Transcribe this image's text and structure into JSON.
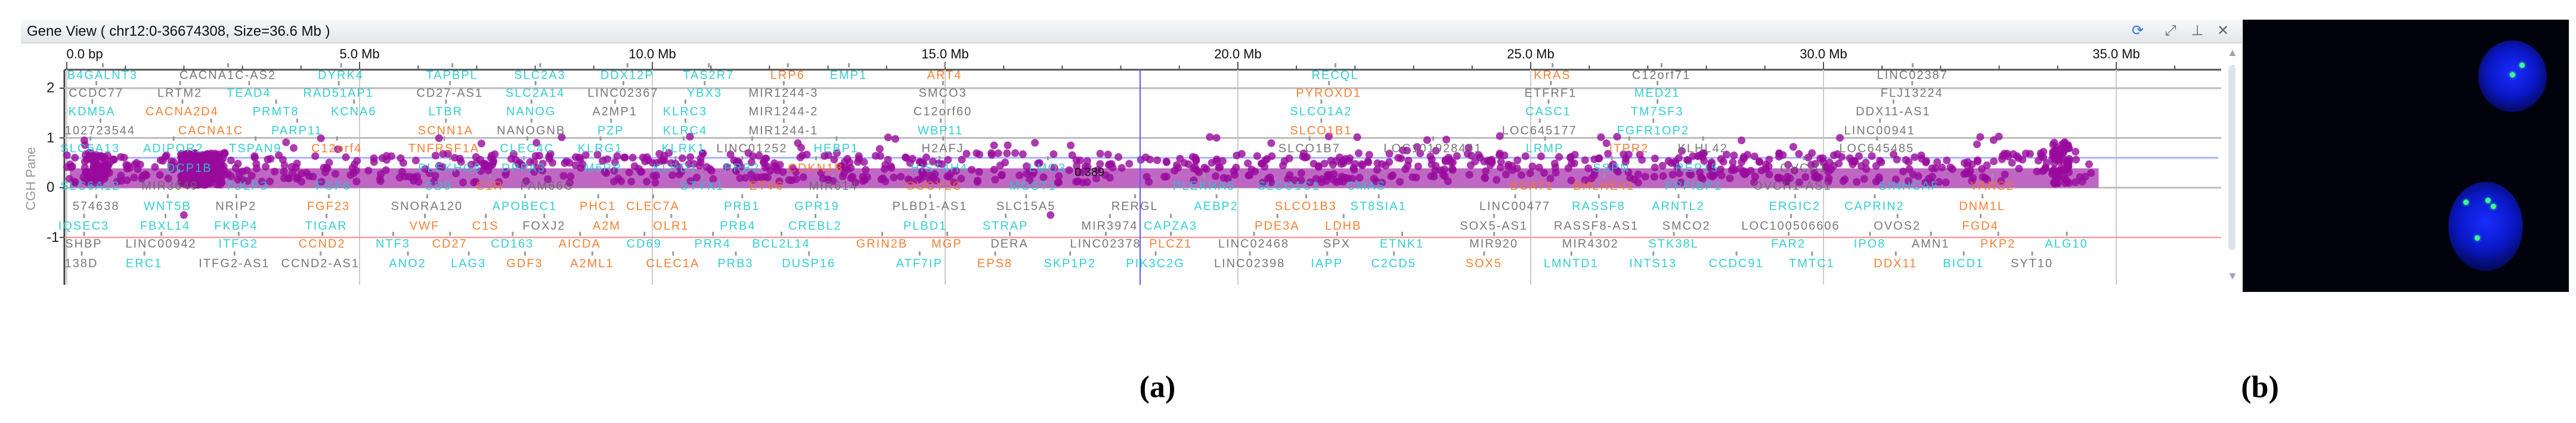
{
  "window": {
    "title": "Gene View ( chr12:0-36674308, Size=36.6 Mb )",
    "icons": [
      "refresh-icon",
      "expand-icon",
      "pin-icon",
      "close-icon"
    ]
  },
  "axis": {
    "x_ticks": [
      {
        "mb": 0,
        "label": "0.0 bp"
      },
      {
        "mb": 5,
        "label": "5.0 Mb"
      },
      {
        "mb": 10,
        "label": "10.0 Mb"
      },
      {
        "mb": 15,
        "label": "15.0 Mb"
      },
      {
        "mb": 20,
        "label": "20.0 Mb"
      },
      {
        "mb": 25,
        "label": "25.0 Mb"
      },
      {
        "mb": 30,
        "label": "30.0 Mb"
      },
      {
        "mb": 35,
        "label": "35.0 Mb"
      }
    ],
    "y_ticks": [
      {
        "v": 2,
        "label": "2"
      },
      {
        "v": 1,
        "label": "1"
      },
      {
        "v": 0,
        "label": "0"
      },
      {
        "v": -1,
        "label": "-1"
      }
    ],
    "y_label": "CGH Pane"
  },
  "colors": {
    "c": "#1fc8cf",
    "o": "#f5731e",
    "g": "#6a6a6a",
    "point": "#980a9c",
    "band": "#b44db8",
    "gain_line": "#aab0ff",
    "loss_line": "#f08a8a",
    "cursor": "#5b5bff"
  },
  "cgh": {
    "segment_mean_label": "0.389",
    "segment_mean": 0.389,
    "segment_start_mb": 0,
    "segment_end_mb": 34.7,
    "gain_threshold": 0.6,
    "loss_threshold": -1,
    "cursor_mb": 18.33
  },
  "gene_rows": [
    [
      [
        "B4GALNT3",
        0.61,
        "c"
      ],
      [
        "CACNA1C-AS2",
        2.75,
        "g"
      ],
      [
        "DYRK4",
        4.68,
        "c"
      ],
      [
        "TAPBPL",
        6.58,
        "c"
      ],
      [
        "SLC2A3",
        8.08,
        "c"
      ],
      [
        "DDX12P",
        9.57,
        "c"
      ],
      [
        "TAS2R7",
        10.96,
        "c"
      ],
      [
        "LRP6",
        12.31,
        "o"
      ],
      [
        "EMP1",
        13.35,
        "c"
      ],
      [
        "ART4",
        14.99,
        "o"
      ],
      [
        "RECQL",
        21.66,
        "c"
      ],
      [
        "KRAS",
        25.37,
        "o"
      ],
      [
        "C12orf71",
        27.23,
        "g"
      ],
      [
        "LINC02387",
        31.52,
        "g"
      ]
    ],
    [
      [
        "CCDC77",
        0.5,
        "g"
      ],
      [
        "LRTM2",
        1.93,
        "g"
      ],
      [
        "TEAD4",
        3.11,
        "c"
      ],
      [
        "RAD51AP1",
        4.64,
        "c"
      ],
      [
        "CD27-AS1",
        6.54,
        "g"
      ],
      [
        "SLC2A14",
        8.0,
        "c"
      ],
      [
        "LINC02367",
        9.5,
        "g"
      ],
      [
        "YBX3",
        10.89,
        "c"
      ],
      [
        "MIR1244-3",
        12.24,
        "g"
      ],
      [
        "SMCO3",
        14.96,
        "g"
      ],
      [
        "PYROXD1",
        21.55,
        "o"
      ],
      [
        "ETFRF1",
        25.34,
        "g"
      ],
      [
        "MED21",
        27.16,
        "c"
      ],
      [
        "FLJ13224",
        31.51,
        "g"
      ]
    ],
    [
      [
        "KDM5A",
        0.43,
        "c"
      ],
      [
        "CACNA2D4",
        1.97,
        "o"
      ],
      [
        "PRMT8",
        3.57,
        "c"
      ],
      [
        "KCNA6",
        4.9,
        "c"
      ],
      [
        "LTBR",
        6.47,
        "c"
      ],
      [
        "NANOG",
        7.93,
        "c"
      ],
      [
        "A2MP1",
        9.36,
        "g"
      ],
      [
        "KLRC3",
        10.56,
        "c"
      ],
      [
        "MIR1244-2",
        12.24,
        "g"
      ],
      [
        "C12orf60",
        14.96,
        "g"
      ],
      [
        "SLCO1A2",
        21.42,
        "c"
      ],
      [
        "CASC1",
        25.3,
        "c"
      ],
      [
        "TM7SF3",
        27.16,
        "c"
      ],
      [
        "DDX11-AS1",
        31.19,
        "g"
      ]
    ],
    [
      [
        "102723544",
        0.57,
        "g"
      ],
      [
        "CACNA1C",
        2.46,
        "o"
      ],
      [
        "PARP11",
        3.93,
        "c"
      ],
      [
        "SCNN1A",
        6.47,
        "o"
      ],
      [
        "NANOGNB",
        7.93,
        "g"
      ],
      [
        "PZP",
        9.29,
        "c"
      ],
      [
        "KLRC4",
        10.56,
        "c"
      ],
      [
        "MIR1244-1",
        12.24,
        "g"
      ],
      [
        "WBP11",
        14.92,
        "c"
      ],
      [
        "SLCO1B1",
        21.42,
        "o"
      ],
      [
        "LOC645177",
        25.15,
        "g"
      ],
      [
        "FGFR1OP2",
        27.09,
        "c"
      ],
      [
        "LINC00941",
        30.96,
        "g"
      ]
    ],
    [
      [
        "SLC6A13",
        0.4,
        "c"
      ],
      [
        "ADIPOR2",
        1.82,
        "c"
      ],
      [
        "TSPAN9",
        3.22,
        "c"
      ],
      [
        "C12orf4",
        4.61,
        "o"
      ],
      [
        "TNFRSF1A",
        6.44,
        "o"
      ],
      [
        "CLEC4C",
        7.86,
        "c"
      ],
      [
        "KLRG1",
        9.11,
        "c"
      ],
      [
        "KLRK1",
        10.53,
        "c"
      ],
      [
        "LINC01252",
        11.7,
        "g"
      ],
      [
        "HEBP1",
        13.14,
        "c"
      ],
      [
        "H2AFJ",
        14.96,
        "g"
      ],
      [
        "SLCO1B7",
        21.22,
        "g"
      ],
      [
        "LOC101928441",
        23.33,
        "g"
      ],
      [
        "LRMP",
        25.24,
        "c"
      ],
      [
        "ITPR2",
        26.68,
        "o"
      ],
      [
        "KLHL42",
        27.94,
        "g"
      ],
      [
        "LOC645485",
        30.91,
        "g"
      ]
    ],
    [
      [
        "DCP1B",
        2.09,
        "c"
      ],
      [
        "PLEKHG6",
        6.54,
        "c"
      ],
      [
        "DPPA3",
        7.8,
        "c"
      ],
      [
        "M6PR",
        9.16,
        "c"
      ],
      [
        "KLRD1",
        10.39,
        "c"
      ],
      [
        "PRB2",
        11.53,
        "c"
      ],
      [
        "CDKN1B",
        12.79,
        "o"
      ],
      [
        "HIST4H4",
        14.9,
        "c"
      ],
      [
        "LMO3",
        16.75,
        "c"
      ],
      [
        "SSPN",
        26.38,
        "c"
      ],
      [
        "REP15",
        27.84,
        "c"
      ],
      [
        "OVCH1",
        29.66,
        "g"
      ]
    ],
    [
      [
        "SLC6A12",
        0.4,
        "c"
      ],
      [
        "MIR3649",
        1.76,
        "g"
      ],
      [
        "TULP3",
        3.07,
        "c"
      ],
      [
        "FGF6",
        4.55,
        "c"
      ],
      [
        "CD9",
        6.34,
        "c"
      ],
      [
        "C1R",
        7.22,
        "o"
      ],
      [
        "FAM66C",
        8.2,
        "g"
      ],
      [
        "STYK1",
        10.85,
        "c"
      ],
      [
        "ETV6",
        11.95,
        "o"
      ],
      [
        "MIR614",
        13.09,
        "g"
      ],
      [
        "GUCY2C",
        14.81,
        "o"
      ],
      [
        "MGST1",
        16.5,
        "c"
      ],
      [
        "PLEKHA5",
        19.42,
        "c"
      ],
      [
        "SLCO1C1",
        20.87,
        "c"
      ],
      [
        "CMAS",
        22.19,
        "c"
      ],
      [
        "BCAT1",
        25.02,
        "o"
      ],
      [
        "BHLHE41",
        26.25,
        "o"
      ],
      [
        "PPFIBP1",
        27.78,
        "c"
      ],
      [
        "OVCH1-AS1",
        29.47,
        "g"
      ],
      [
        "SINHCAF",
        31.46,
        "c"
      ],
      [
        "YARS2",
        32.88,
        "o"
      ]
    ],
    [
      [
        "574638",
        0.5,
        "g"
      ],
      [
        "WNT5B",
        1.72,
        "c"
      ],
      [
        "NRIP2",
        2.89,
        "g"
      ],
      [
        "FGF23",
        4.47,
        "o"
      ],
      [
        "SNORA120",
        6.15,
        "g"
      ],
      [
        "APOBEC1",
        7.82,
        "c"
      ],
      [
        "PHC1",
        9.07,
        "o"
      ],
      [
        "CLEC7A",
        10.01,
        "o"
      ],
      [
        "PRB1",
        11.53,
        "c"
      ],
      [
        "GPR19",
        12.81,
        "c"
      ],
      [
        "PLBD1-AS1",
        14.74,
        "g"
      ],
      [
        "SLC15A5",
        16.38,
        "g"
      ],
      [
        "RERGL",
        18.24,
        "g"
      ],
      [
        "AEBP2",
        19.63,
        "c"
      ],
      [
        "SLCO1B3",
        21.16,
        "o"
      ],
      [
        "ST8SIA1",
        22.4,
        "c"
      ],
      [
        "LINC00477",
        24.73,
        "g"
      ],
      [
        "RASSF8",
        26.16,
        "c"
      ],
      [
        "ARNTL2",
        27.52,
        "c"
      ],
      [
        "ERGIC2",
        29.51,
        "c"
      ],
      [
        "CAPRIN2",
        30.87,
        "c"
      ],
      [
        "DNM1L",
        32.71,
        "o"
      ]
    ],
    [
      [
        "IQSEC3",
        0.29,
        "c"
      ],
      [
        "FBXL14",
        1.68,
        "c"
      ],
      [
        "FKBP4",
        2.89,
        "c"
      ],
      [
        "TIGAR",
        4.43,
        "c"
      ],
      [
        "VWF",
        6.11,
        "o"
      ],
      [
        "C1S",
        7.15,
        "o"
      ],
      [
        "FOXJ2",
        8.15,
        "g"
      ],
      [
        "A2M",
        9.22,
        "o"
      ],
      [
        "OLR1",
        10.32,
        "o"
      ],
      [
        "PRB4",
        11.46,
        "c"
      ],
      [
        "CREBL2",
        12.78,
        "c"
      ],
      [
        "PLBD1",
        14.66,
        "c"
      ],
      [
        "STRAP",
        16.03,
        "c"
      ],
      [
        "MIR3974",
        17.81,
        "g"
      ],
      [
        "CAPZA3",
        18.85,
        "c"
      ],
      [
        "PDE3A",
        20.67,
        "o"
      ],
      [
        "LDHB",
        21.8,
        "o"
      ],
      [
        "SOX5-AS1",
        24.37,
        "g"
      ],
      [
        "RASSF8-AS1",
        26.12,
        "g"
      ],
      [
        "SMCO2",
        27.66,
        "g"
      ],
      [
        "LOC100506606",
        29.44,
        "g"
      ],
      [
        "OVOS2",
        31.26,
        "g"
      ],
      [
        "FGD4",
        32.68,
        "o"
      ]
    ],
    [
      [
        "SHBP",
        0.29,
        "g"
      ],
      [
        "LINC00942",
        1.61,
        "g"
      ],
      [
        "ITFG2",
        2.93,
        "c"
      ],
      [
        "CCND2",
        4.36,
        "o"
      ],
      [
        "NTF3",
        5.57,
        "c"
      ],
      [
        "CD27",
        6.54,
        "o"
      ],
      [
        "CD163",
        7.61,
        "c"
      ],
      [
        "AICDA",
        8.76,
        "o"
      ],
      [
        "CD69",
        9.86,
        "c"
      ],
      [
        "PRR4",
        11.03,
        "c"
      ],
      [
        "BCL2L14",
        12.2,
        "c"
      ],
      [
        "GRIN2B",
        13.92,
        "o"
      ],
      [
        "MGP",
        15.03,
        "o"
      ],
      [
        "DERA",
        16.1,
        "g"
      ],
      [
        "LINC02378",
        17.74,
        "g"
      ],
      [
        "PLCZ1",
        18.85,
        "o"
      ],
      [
        "LINC02468",
        20.27,
        "g"
      ],
      [
        "SPX",
        21.69,
        "g"
      ],
      [
        "ETNK1",
        22.8,
        "c"
      ],
      [
        "MIR920",
        24.37,
        "g"
      ],
      [
        "MIR4302",
        26.02,
        "g"
      ],
      [
        "STK38L",
        27.44,
        "c"
      ],
      [
        "FAR2",
        29.4,
        "c"
      ],
      [
        "IPO8",
        30.79,
        "c"
      ],
      [
        "AMN1",
        31.83,
        "g"
      ],
      [
        "PKP2",
        32.98,
        "o"
      ],
      [
        "ALG10",
        34.15,
        "c"
      ]
    ],
    [
      [
        "138D",
        0.25,
        "g"
      ],
      [
        "ERC1",
        1.32,
        "c"
      ],
      [
        "ITFG2-AS1",
        2.86,
        "g"
      ],
      [
        "CCND2-AS1",
        4.33,
        "g"
      ],
      [
        "ANO2",
        5.82,
        "c"
      ],
      [
        "LAG3",
        6.86,
        "c"
      ],
      [
        "GDF3",
        7.82,
        "o"
      ],
      [
        "A2ML1",
        8.97,
        "o"
      ],
      [
        "CLEC1A",
        10.35,
        "o"
      ],
      [
        "PRB3",
        11.42,
        "c"
      ],
      [
        "DUSP16",
        12.67,
        "c"
      ],
      [
        "ATF7IP",
        14.56,
        "c"
      ],
      [
        "EPS8",
        15.85,
        "o"
      ],
      [
        "SKP1P2",
        17.13,
        "c"
      ],
      [
        "PIK3C2G",
        18.59,
        "c"
      ],
      [
        "LINC02398",
        20.2,
        "g"
      ],
      [
        "IAPP",
        21.52,
        "c"
      ],
      [
        "C2CD5",
        22.66,
        "c"
      ],
      [
        "SOX5",
        24.2,
        "o"
      ],
      [
        "LMNTD1",
        25.69,
        "c"
      ],
      [
        "INTS13",
        27.09,
        "c"
      ],
      [
        "CCDC91",
        28.51,
        "c"
      ],
      [
        "TMTC1",
        29.8,
        "c"
      ],
      [
        "DDX11",
        31.23,
        "o"
      ],
      [
        "BICD1",
        32.39,
        "c"
      ],
      [
        "SYT10",
        33.56,
        "g"
      ]
    ]
  ],
  "captions": {
    "a": "(a)",
    "b": "(b)"
  }
}
